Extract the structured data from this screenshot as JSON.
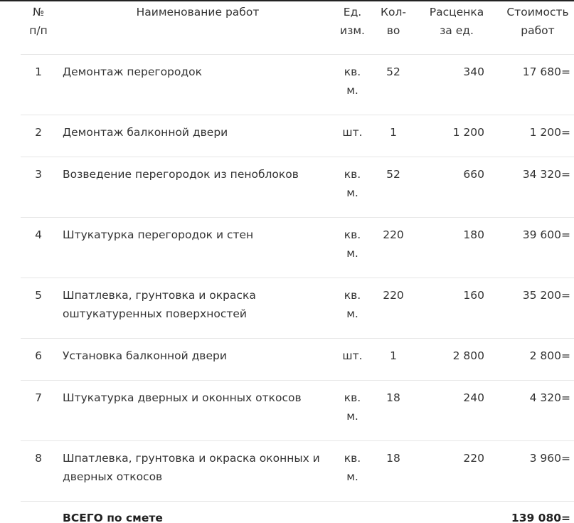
{
  "header": {
    "num": "№\nп/п",
    "name": "Наименование работ",
    "unit": "Ед.\nизм.",
    "qty": "Кол-\nво",
    "price": "Расценка\nза ед.",
    "cost": "Стоимость\nработ"
  },
  "rows": [
    {
      "num": "1",
      "name": "Демонтаж перегородок",
      "unit": "кв.\nм.",
      "qty": "52",
      "price": "340",
      "cost": "17 680="
    },
    {
      "num": "2",
      "name": "Демонтаж балконной двери",
      "unit": "шт.",
      "qty": "1",
      "price": "1 200",
      "cost": "1 200="
    },
    {
      "num": "3",
      "name": "Возведение перегородок из пеноблоков",
      "unit": "кв.\nм.",
      "qty": "52",
      "price": "660",
      "cost": "34 320="
    },
    {
      "num": "4",
      "name": "Штукатурка перегородок и стен",
      "unit": "кв.\nм.",
      "qty": "220",
      "price": "180",
      "cost": "39 600="
    },
    {
      "num": "5",
      "name": "Шпатлевка, грунтовка и окраска оштукатуренных поверхностей",
      "unit": "кв.\nм.",
      "qty": "220",
      "price": "160",
      "cost": "35 200="
    },
    {
      "num": "6",
      "name": "Установка балконной двери",
      "unit": "шт.",
      "qty": "1",
      "price": "2 800",
      "cost": "2 800="
    },
    {
      "num": "7",
      "name": "Штукатурка дверных и оконных откосов",
      "unit": "кв.\nм.",
      "qty": "18",
      "price": "240",
      "cost": "4 320="
    },
    {
      "num": "8",
      "name": "Шпатлевка, грунтовка и окраска оконных и дверных откосов",
      "unit": "кв.\nм.",
      "qty": "18",
      "price": "220",
      "cost": "3 960="
    }
  ],
  "total": {
    "label": "ВСЕГО по смете",
    "value": "139 080="
  }
}
